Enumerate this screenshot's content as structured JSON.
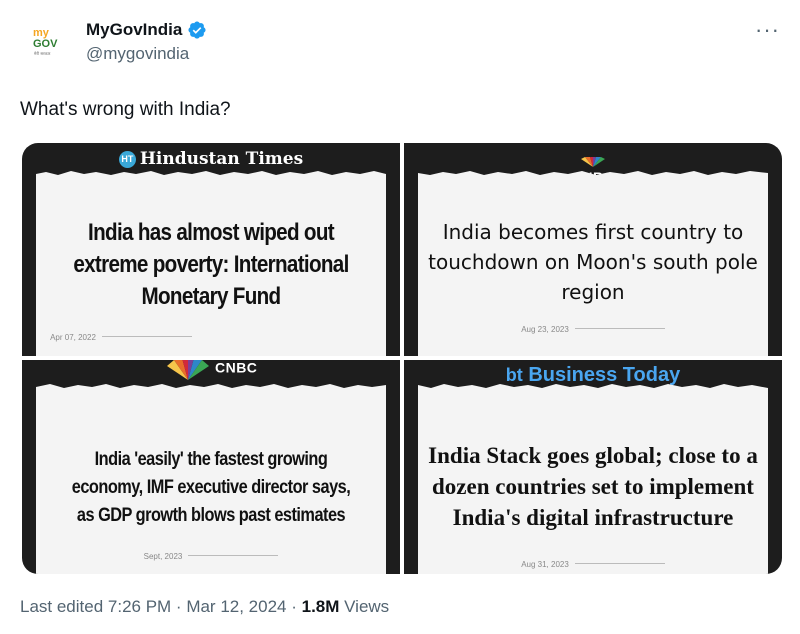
{
  "account": {
    "display_name": "MyGovIndia",
    "handle": "@mygovindia",
    "avatar_text_top": "my",
    "avatar_text_main": "GOV",
    "avatar_tagline": "मेरी सरकार",
    "verified_color": "#1d9bf0"
  },
  "tweet": {
    "text": "What's wrong with India?"
  },
  "media": [
    {
      "brand": "Hindustan Times",
      "brand_logo_text": "HT",
      "headline": "India has almost wiped out extreme poverty: International Monetary Fund",
      "date": "Apr 07, 2022"
    },
    {
      "brand": "CNBC",
      "headline": "India becomes first country to touchdown on Moon's south pole region",
      "date": "Aug 23, 2023"
    },
    {
      "brand": "CNBC",
      "headline": "India 'easily' the fastest growing economy, IMF executive director says, as GDP growth blows past estimates",
      "date": "Sept, 2023"
    },
    {
      "brand": "Business Today",
      "brand_logo_text": "bt",
      "headline": "India Stack goes global; close to a dozen countries set to implement India's digital infrastructure",
      "date": "Aug 31, 2023"
    }
  ],
  "footer": {
    "edited_label": "Last edited 7:26 PM · Mar 12, 2024 · ",
    "views_count": "1.8M",
    "views_label": " Views"
  },
  "icons": {
    "more": "more-options-icon",
    "verified": "verified-badge-icon"
  }
}
